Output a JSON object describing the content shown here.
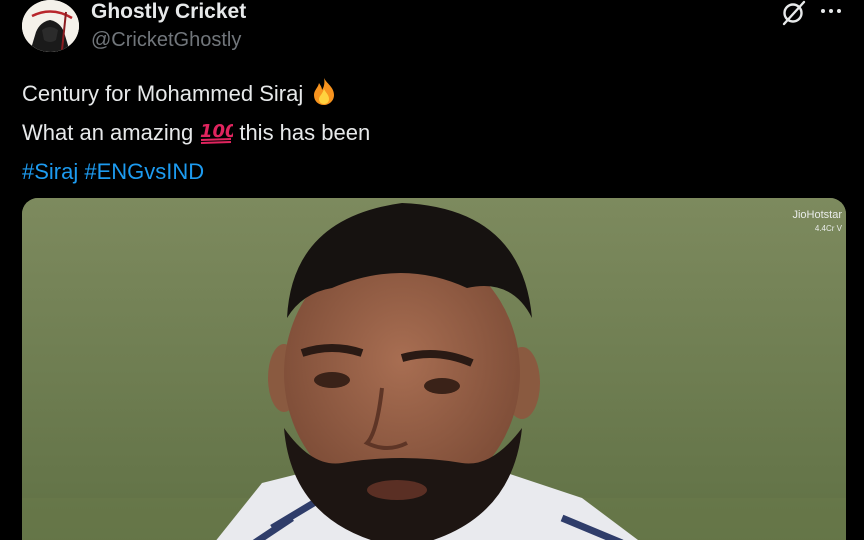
{
  "author": {
    "display_name": "Ghostly Cricket",
    "handle": "@CricketGhostly",
    "avatar_icon": "ghost-reaper-logo-icon",
    "avatar_logo_text": "Ghostly Cricket"
  },
  "header_actions": {
    "grok_icon": "grok-icon",
    "more_icon": "more-options-icon"
  },
  "tweet": {
    "line1": "Century for Mohammed Siraj",
    "line1_emoji": "fire-emoji",
    "line2_before": "What an amazing",
    "line2_emoji": "hundred-points-emoji",
    "line2_after": "this has been",
    "hashtags": [
      "#Siraj",
      "#ENGvsIND"
    ]
  },
  "media": {
    "watermark": "JioHotstar",
    "views": "4.4Cr V"
  },
  "colors": {
    "background": "#000000",
    "text": "#e7e9ea",
    "secondary": "#71767b",
    "link": "#1d9bf0"
  }
}
